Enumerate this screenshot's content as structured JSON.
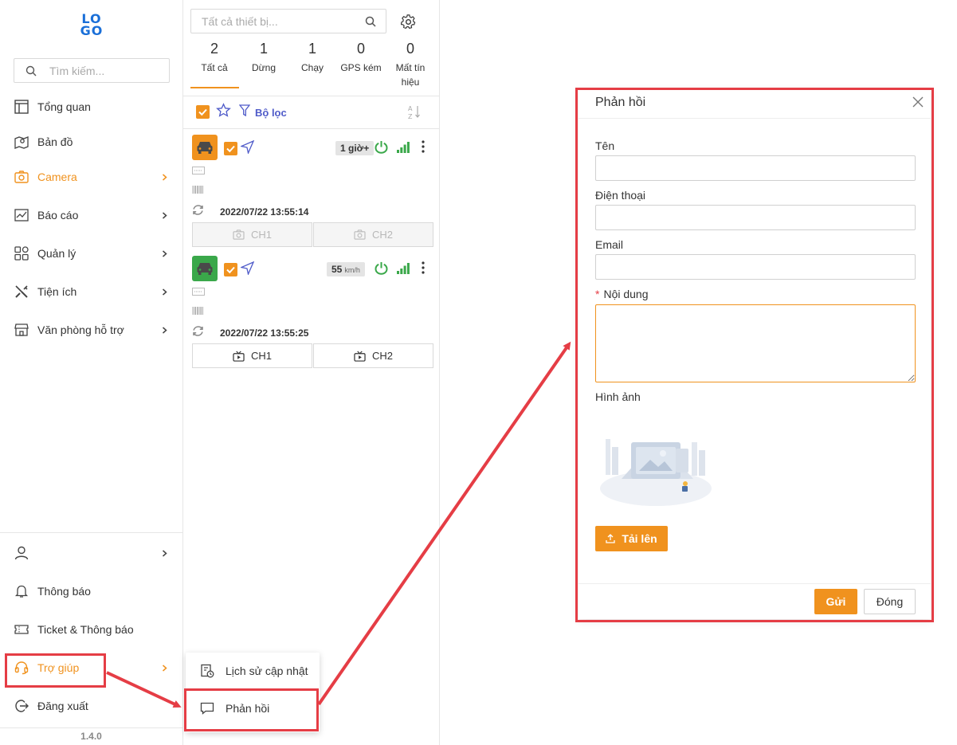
{
  "brand": {
    "logo_text": "LOGO",
    "accent": "#f0921e",
    "highlight": "#e53d45",
    "link": "#4f5bc9"
  },
  "sidebar": {
    "search_placeholder": "Tìm kiếm...",
    "items": [
      {
        "label": "Tổng quan",
        "icon": "layout-icon",
        "chevron": false
      },
      {
        "label": "Bản đồ",
        "icon": "map-pin-icon",
        "chevron": false
      },
      {
        "label": "Camera",
        "icon": "camera-icon",
        "chevron": true,
        "active": true
      },
      {
        "label": "Báo cáo",
        "icon": "chart-icon",
        "chevron": true
      },
      {
        "label": "Quản lý",
        "icon": "grid-icon",
        "chevron": true
      },
      {
        "label": "Tiện ích",
        "icon": "tools-icon",
        "chevron": true
      },
      {
        "label": "Văn phòng hỗ trợ",
        "icon": "shop-icon",
        "chevron": true
      }
    ],
    "bottom": [
      {
        "label": "",
        "icon": "user-icon",
        "chevron": true
      },
      {
        "label": "Thông báo",
        "icon": "bell-icon",
        "chevron": false
      },
      {
        "label": "Ticket & Thông báo",
        "icon": "ticket-icon",
        "chevron": false
      },
      {
        "label": "Trợ giúp",
        "icon": "headset-icon",
        "chevron": true,
        "active": true
      },
      {
        "label": "Đăng xuất",
        "icon": "logout-icon",
        "chevron": false
      }
    ],
    "version": "1.4.0"
  },
  "devices": {
    "search_placeholder": "Tất cả thiết bị...",
    "stats": [
      {
        "count": "2",
        "label": "Tất cả"
      },
      {
        "count": "1",
        "label": "Dừng"
      },
      {
        "count": "1",
        "label": "Chạy"
      },
      {
        "count": "0",
        "label": "GPS kém"
      },
      {
        "count": "0",
        "label": "Mất tín hiệu"
      }
    ],
    "filter_label": "Bộ lọc",
    "list": [
      {
        "status_color": "#f0921e",
        "badge": "1 giờ+",
        "badge_unit": "",
        "timestamp": "2022/07/22 13:55:14",
        "ch1": "CH1",
        "ch2": "CH2",
        "channels_enabled": false
      },
      {
        "status_color": "#3aa84a",
        "badge": "55",
        "badge_unit": "km/h",
        "timestamp": "2022/07/22 13:55:25",
        "ch1": "CH1",
        "ch2": "CH2",
        "channels_enabled": true
      }
    ]
  },
  "help_menu": {
    "items": [
      {
        "label": "Lịch sử cập nhật",
        "icon": "history-icon"
      },
      {
        "label": "Phản hồi",
        "icon": "comment-icon"
      }
    ]
  },
  "feedback": {
    "title": "Phản hồi",
    "name_label": "Tên",
    "phone_label": "Điện thoại",
    "email_label": "Email",
    "content_label": "Nội dung",
    "image_label": "Hình ảnh",
    "upload_label": "Tải lên",
    "send_label": "Gửi",
    "close_label": "Đóng"
  }
}
